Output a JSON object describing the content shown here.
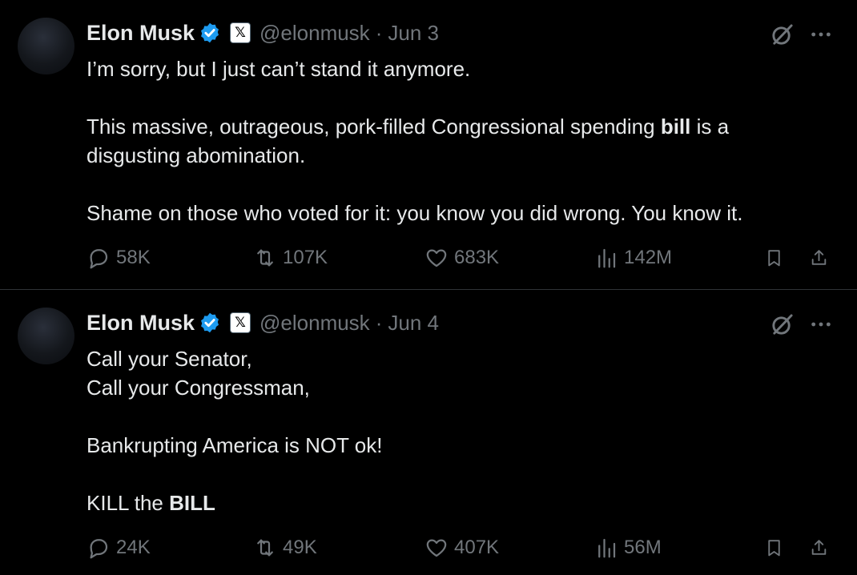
{
  "tweets": [
    {
      "author": "Elon Musk",
      "handle": "@elonmusk",
      "separator": "·",
      "date": "Jun 3",
      "badge": "𝕏",
      "paragraphs": [
        [
          "I’m sorry, but I just can’t stand it anymore."
        ],
        [
          "This massive, outrageous, pork-filled Congressional spending ",
          "bill",
          " is a\ndisgusting abomination."
        ],
        [
          "Shame on those who voted for it: you know you did wrong. You know it."
        ]
      ],
      "stats": {
        "replies": "58K",
        "reposts": "107K",
        "likes": "683K",
        "views": "142M"
      }
    },
    {
      "author": "Elon Musk",
      "handle": "@elonmusk",
      "separator": "·",
      "date": "Jun 4",
      "badge": "𝕏",
      "paragraphs": [
        [
          "Call your Senator,\nCall your Congressman,"
        ],
        [
          "Bankrupting America is NOT ok!"
        ],
        [
          "KILL the ",
          "BILL"
        ]
      ],
      "stats": {
        "replies": "24K",
        "reposts": "49K",
        "likes": "407K",
        "views": "56M"
      }
    }
  ],
  "colors": {
    "background": "#000000",
    "text": "#e7e9ea",
    "muted": "#71767b",
    "verified": "#1d9bf0",
    "divider": "#2f3336"
  },
  "icons": [
    "verified-badge-icon",
    "x-logo-icon",
    "grok-icon",
    "more-icon",
    "reply-icon",
    "repost-icon",
    "like-icon",
    "views-icon",
    "bookmark-icon",
    "share-icon"
  ]
}
